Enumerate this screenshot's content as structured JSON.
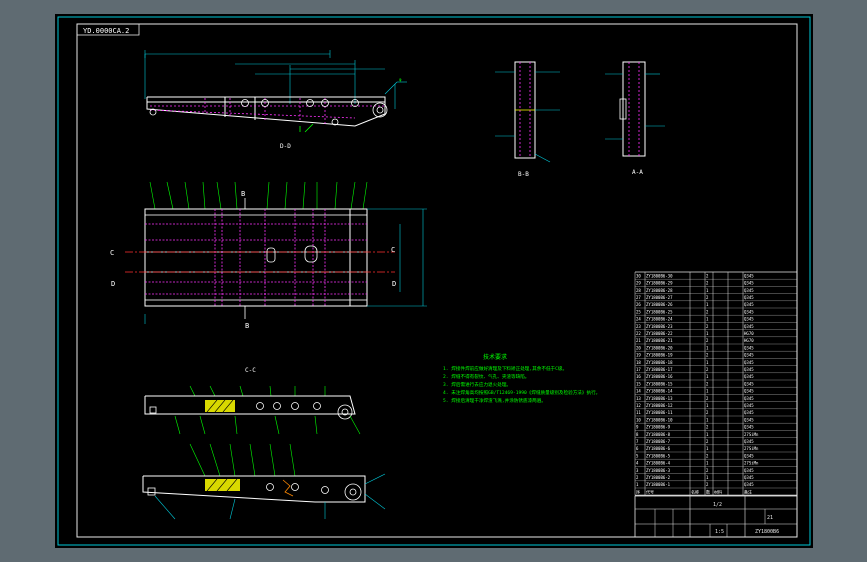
{
  "drawing_code_box": "YD.0000CA.2",
  "views": {
    "side_top": {
      "label": "D-D"
    },
    "plan": {
      "label_c_left": "C",
      "label_c_right": "C",
      "label_d_left": "D",
      "label_d_right": "D",
      "label_b_top": "B",
      "label_b_bottom": "B"
    },
    "section_bb": {
      "label": "B-B"
    },
    "section_aa": {
      "label": "A-A"
    },
    "section_cc": {
      "label": "C-C"
    }
  },
  "tech_requirements": {
    "title": "技术要求",
    "items": [
      "1. 焊接件焊前应做好清理及下料矫正处理,其余不低于C级。",
      "2. 焊缝不得有裂纹、气孔、夹渣等缺陷。",
      "3. 焊后需进行去应力退火处理。",
      "4. 未注焊角高均按照GB/T12469-1990《焊缝质量级别及检验方法》执行。",
      "5. 焊接后清理干净焊渣飞溅,并涂防锈底漆两遍。"
    ]
  },
  "parts_table": {
    "rows": [
      [
        "30",
        "ZY1800B6-30",
        "",
        "2",
        "",
        "",
        "Q345"
      ],
      [
        "29",
        "ZY1800B6-29",
        "",
        "2",
        "",
        "",
        "Q345"
      ],
      [
        "28",
        "ZY1800B6-28",
        "",
        "1",
        "",
        "",
        "Q345"
      ],
      [
        "27",
        "ZY1800B6-27",
        "",
        "2",
        "",
        "",
        "Q345"
      ],
      [
        "26",
        "ZY1800B6-26",
        "",
        "1",
        "",
        "",
        "Q345"
      ],
      [
        "25",
        "ZY1800B6-25",
        "",
        "2",
        "",
        "",
        "Q345"
      ],
      [
        "24",
        "ZY1800B6-24",
        "",
        "1",
        "",
        "",
        "Q345"
      ],
      [
        "23",
        "ZY1800B6-23",
        "",
        "2",
        "",
        "",
        "Q345"
      ],
      [
        "22",
        "ZY1800B6-22",
        "",
        "1",
        "",
        "",
        "HG70"
      ],
      [
        "21",
        "ZY1800B6-21",
        "",
        "2",
        "",
        "",
        "HG70"
      ],
      [
        "20",
        "ZY1800B6-20",
        "",
        "1",
        "",
        "",
        "Q345"
      ],
      [
        "19",
        "ZY1800B6-19",
        "",
        "2",
        "",
        "",
        "Q345"
      ],
      [
        "18",
        "ZY1800B6-18",
        "",
        "1",
        "",
        "",
        "Q345"
      ],
      [
        "17",
        "ZY1800B6-17",
        "",
        "2",
        "",
        "",
        "Q345"
      ],
      [
        "16",
        "ZY1800B6-16",
        "",
        "1",
        "",
        "",
        "Q345"
      ],
      [
        "15",
        "ZY1800B6-15",
        "",
        "2",
        "",
        "",
        "Q345"
      ],
      [
        "14",
        "ZY1800B6-14",
        "",
        "1",
        "",
        "",
        "Q345"
      ],
      [
        "13",
        "ZY1800B6-13",
        "",
        "2",
        "",
        "",
        "Q345"
      ],
      [
        "12",
        "ZY1800B6-12",
        "",
        "1",
        "",
        "",
        "Q345"
      ],
      [
        "11",
        "ZY1800B6-11",
        "",
        "2",
        "",
        "",
        "Q345"
      ],
      [
        "10",
        "ZY1800B6-10",
        "",
        "1",
        "",
        "",
        "Q345"
      ],
      [
        "9",
        "ZY1800B6-9",
        "",
        "2",
        "",
        "",
        "Q345"
      ],
      [
        "8",
        "ZY1800B6-8",
        "",
        "1",
        "",
        "",
        "27SiMn"
      ],
      [
        "7",
        "ZY1800B6-7",
        "",
        "2",
        "",
        "",
        "Q345"
      ],
      [
        "6",
        "ZY1800B6-6",
        "",
        "1",
        "",
        "",
        "27SiMn"
      ],
      [
        "5",
        "ZY1800B6-5",
        "",
        "2",
        "",
        "",
        "Q345"
      ],
      [
        "4",
        "ZY1800B6-4",
        "",
        "1",
        "",
        "",
        "27SiMn"
      ],
      [
        "3",
        "ZY1800B6-3",
        "",
        "2",
        "",
        "",
        "Q345"
      ],
      [
        "2",
        "ZY1800B6-2",
        "",
        "1",
        "",
        "",
        "Q345"
      ],
      [
        "1",
        "ZY1800B6-1",
        "",
        "2",
        "",
        "",
        "Q345"
      ]
    ],
    "header": [
      "序",
      "代号",
      "名称",
      "数",
      "材料",
      "",
      "备注"
    ],
    "title_block": {
      "big_code": "ZY1800B6",
      "scale": "1:5",
      "sheet": "1/2",
      "part_name": "顶梁",
      "weight": "21",
      "drawing_no": "ZY1800B6"
    }
  }
}
